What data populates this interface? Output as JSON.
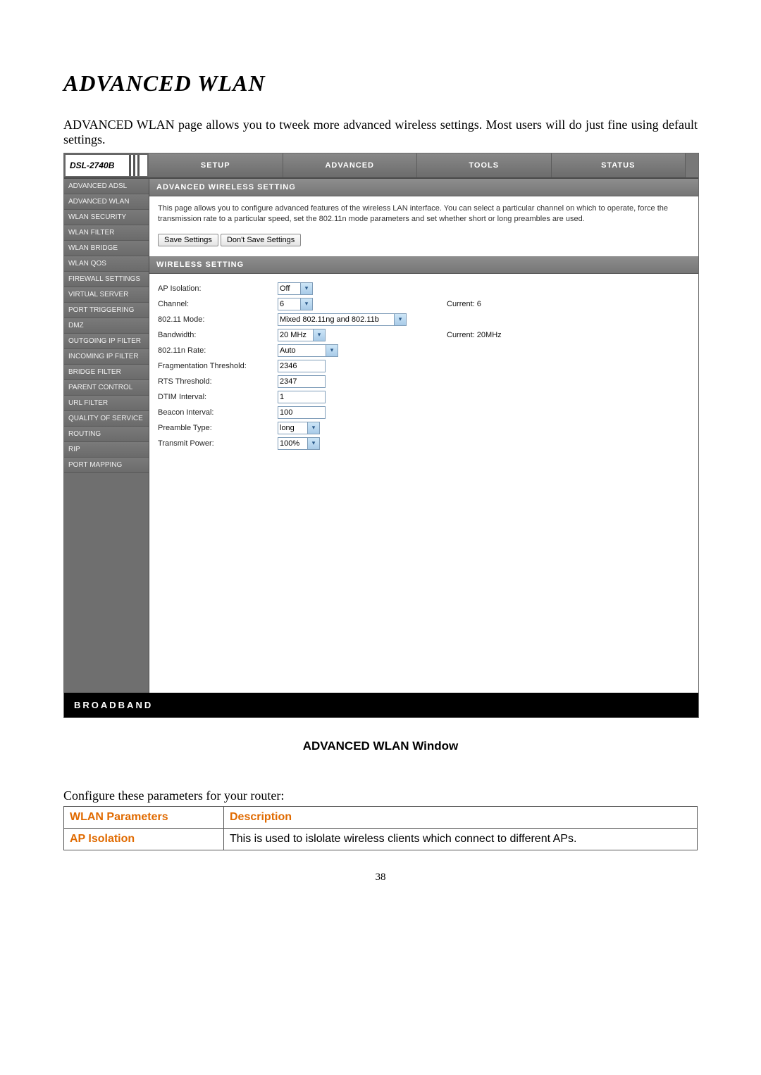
{
  "page": {
    "title": "ADVANCED WLAN",
    "intro": "ADVANCED WLAN page allows you to tweek more advanced wireless settings. Most users will do just fine using default settings.",
    "caption": "ADVANCED WLAN Window",
    "config_line": "Configure these parameters for your router:",
    "page_number": "38"
  },
  "router": {
    "brand": "DSL-2740B",
    "tabs": {
      "setup": "SETUP",
      "advanced": "ADVANCED",
      "tools": "TOOLS",
      "status": "STATUS"
    },
    "sidebar": [
      "ADVANCED ADSL",
      "ADVANCED WLAN",
      "WLAN SECURITY",
      "WLAN FILTER",
      "WLAN BRIDGE",
      "WLAN QOS",
      "FIREWALL SETTINGS",
      "VIRTUAL SERVER",
      "PORT TRIGGERING",
      "DMZ",
      "OUTGOING IP FILTER",
      "INCOMING IP FILTER",
      "BRIDGE FILTER",
      "PARENT CONTROL",
      "URL FILTER",
      "QUALITY OF SERVICE",
      "ROUTING",
      "RIP",
      "PORT MAPPING"
    ],
    "panel1": {
      "title": "ADVANCED WIRELESS SETTING",
      "desc": "This page allows you to configure advanced features of the wireless LAN interface. You can select a particular channel on which to operate, force the transmission rate to a particular speed, set the 802.11n mode parameters and set whether short or long preambles are used.",
      "btn_save": "Save Settings",
      "btn_dont": "Don't Save Settings"
    },
    "panel2": {
      "title": "WIRELESS SETTING",
      "rows": {
        "ap_isolation": {
          "label": "AP Isolation:",
          "value": "Off"
        },
        "channel": {
          "label": "Channel:",
          "value": "6",
          "extra": "Current: 6"
        },
        "mode": {
          "label": "802.11 Mode:",
          "value": "Mixed 802.11ng and 802.11b"
        },
        "bandwidth": {
          "label": "Bandwidth:",
          "value": "20 MHz",
          "extra": "Current: 20MHz"
        },
        "rate": {
          "label": "802.11n Rate:",
          "value": "Auto"
        },
        "frag": {
          "label": "Fragmentation Threshold:",
          "value": "2346"
        },
        "rts": {
          "label": "RTS Threshold:",
          "value": "2347"
        },
        "dtim": {
          "label": "DTIM Interval:",
          "value": "1"
        },
        "beacon": {
          "label": "Beacon Interval:",
          "value": "100"
        },
        "preamble": {
          "label": "Preamble Type:",
          "value": "long"
        },
        "tx": {
          "label": "Transmit Power:",
          "value": "100%"
        }
      }
    },
    "footer": "BROADBAND"
  },
  "table": {
    "h1": "WLAN Parameters",
    "h2": "Description",
    "row1_param": "AP Isolation",
    "row1_desc": "This is used to islolate wireless clients which connect to different APs."
  }
}
